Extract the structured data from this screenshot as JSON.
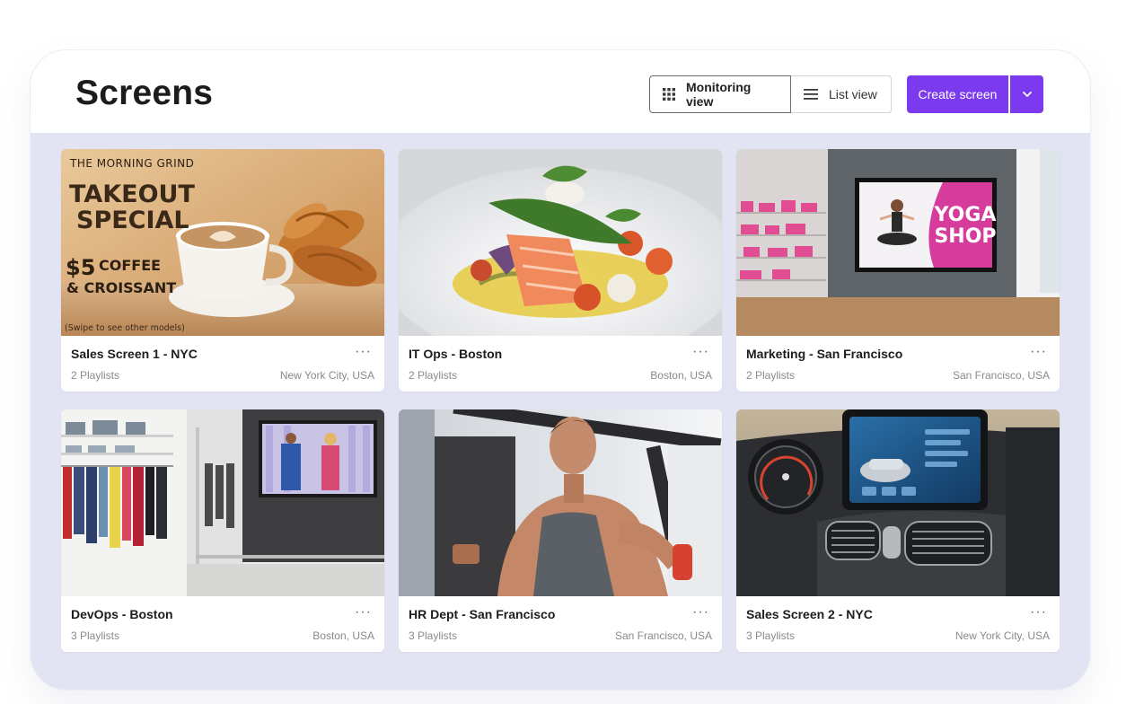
{
  "header": {
    "title": "Screens",
    "view_toggle": {
      "monitoring": "Monitoring view",
      "list": "List view"
    },
    "create_label": "Create screen"
  },
  "screens": [
    {
      "name": "Sales Screen 1 - NYC",
      "playlists": "2 Playlists",
      "location": "New York City, USA",
      "image": {
        "kicker": "THE MORNING GRIND",
        "line1": "TAKEOUT",
        "line2": "SPECIAL",
        "price": "$5",
        "item1": "COFFEE",
        "item2": "& CROISSANT",
        "note": "(Swipe to see other models)"
      }
    },
    {
      "name": "IT Ops - Boston",
      "playlists": "2 Playlists",
      "location": "Boston, USA"
    },
    {
      "name": "Marketing - San Francisco",
      "playlists": "2 Playlists",
      "location": "San Francisco, USA",
      "image": {
        "sign1": "YOGA",
        "sign2": "SHOP"
      }
    },
    {
      "name": "DevOps - Boston",
      "playlists": "3 Playlists",
      "location": "Boston, USA"
    },
    {
      "name": "HR Dept - San Francisco",
      "playlists": "3 Playlists",
      "location": "San Francisco, USA"
    },
    {
      "name": "Sales Screen 2 - NYC",
      "playlists": "3 Playlists",
      "location": "New York City, USA"
    }
  ],
  "more_label": "···",
  "colors": {
    "accent": "#7b3aed",
    "canvas": "#e3e4f3"
  }
}
